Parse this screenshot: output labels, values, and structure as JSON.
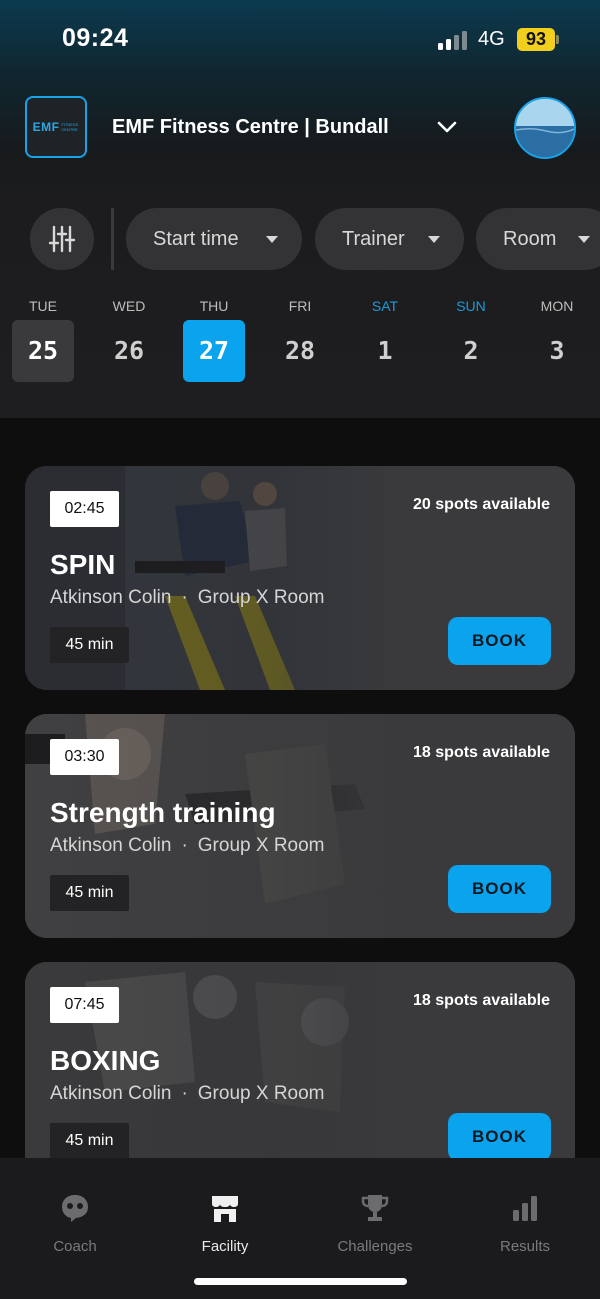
{
  "status": {
    "time": "09:24",
    "network": "4G",
    "battery": "93"
  },
  "header": {
    "logo_text": "EMF",
    "logo_sub": "FITNESS CENTRE",
    "gym_name": "EMF Fitness Centre | Bundall"
  },
  "filters": [
    {
      "label": "Start time"
    },
    {
      "label": "Trainer"
    },
    {
      "label": "Room"
    }
  ],
  "days": [
    {
      "dow": "TUE",
      "num": "25",
      "state": "today"
    },
    {
      "dow": "WED",
      "num": "26",
      "state": ""
    },
    {
      "dow": "THU",
      "num": "27",
      "state": "selected"
    },
    {
      "dow": "FRI",
      "num": "28",
      "state": ""
    },
    {
      "dow": "SAT",
      "num": "1",
      "state": "weekend"
    },
    {
      "dow": "SUN",
      "num": "2",
      "state": "weekend"
    },
    {
      "dow": "MON",
      "num": "3",
      "state": ""
    }
  ],
  "classes": [
    {
      "time": "02:45",
      "spots": "20 spots available",
      "name": "SPIN",
      "trainer": "Atkinson Colin",
      "room": "Group X Room",
      "duration": "45 min",
      "book": "BOOK"
    },
    {
      "time": "03:30",
      "spots": "18 spots available",
      "name": "Strength training",
      "trainer": "Atkinson Colin",
      "room": "Group X Room",
      "duration": "45 min",
      "book": "BOOK"
    },
    {
      "time": "07:45",
      "spots": "18 spots available",
      "name": "BOXING",
      "trainer": "Atkinson Colin",
      "room": "Group X Room",
      "duration": "45 min",
      "book": "BOOK"
    }
  ],
  "tabs": [
    {
      "label": "Coach",
      "icon": "coach-icon",
      "active": false
    },
    {
      "label": "Facility",
      "icon": "facility-icon",
      "active": true
    },
    {
      "label": "Challenges",
      "icon": "trophy-icon",
      "active": false
    },
    {
      "label": "Results",
      "icon": "bar-chart-icon",
      "active": false
    }
  ],
  "colors": {
    "accent": "#0aa3ee",
    "card": "#3a3a3c",
    "background": "#0e0e0f"
  }
}
